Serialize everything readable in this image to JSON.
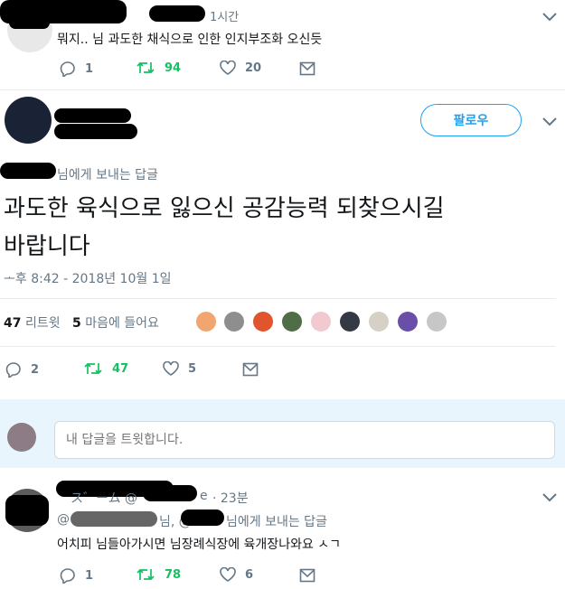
{
  "tweet1": {
    "time": "1시간",
    "text": "뭐지.. 님 과도한 채식으로 인한 인지부조화 오신듯",
    "replies": "1",
    "retweets": "94",
    "likes": "20"
  },
  "main_tweet": {
    "follow_label": "팔로우",
    "reply_to_suffix": "님에게 보내는 답글",
    "text_line1": "과도한 육식으로 잃으신 공감능력 되찾으시길",
    "text_line2": "바랍니다",
    "timestamp": "ᅩ후 8:42 - 2018년 10월 1일",
    "retweet_count": "47",
    "retweet_label": "리트윗",
    "like_count": "5",
    "like_label": "마음에 들어요",
    "replies": "2",
    "retweets": "47",
    "likes": "5"
  },
  "reply_box": {
    "placeholder": "내 답글을 트윗합니다."
  },
  "tweet3": {
    "name_fragment": "ス゛ーム @",
    "handle_fragment": "e",
    "time": "· 23분",
    "reply_to_prefix": "@",
    "reply_to_middle": "님, @",
    "reply_to_suffix": "님에게 보내는 답글",
    "text": "어치피 님들아가시면 님장례식장에 육개장나와요 ㅅㄱ",
    "replies": "1",
    "retweets": "78",
    "likes": "6"
  },
  "colors": {
    "retweet": "#17bf63",
    "muted": "#657786",
    "border": "#e6ecf0"
  }
}
